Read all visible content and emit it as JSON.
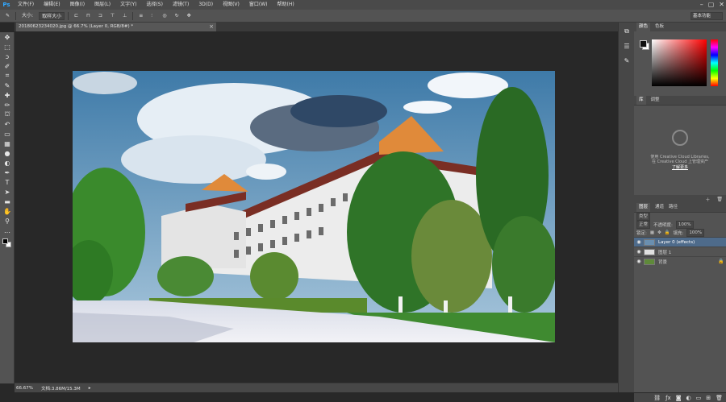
{
  "app": {
    "logo": "Ps"
  },
  "menu": [
    "文件(F)",
    "编辑(E)",
    "图像(I)",
    "图层(L)",
    "文字(Y)",
    "选择(S)",
    "滤镜(T)",
    "3D(D)",
    "视图(V)",
    "窗口(W)",
    "帮助(H)"
  ],
  "window_controls": [
    "–",
    "▢",
    "✕"
  ],
  "options": {
    "size_label": "大小:",
    "sample_label": "取样大小",
    "workspace": "基本功能"
  },
  "document": {
    "tab_title": "20180623234020.jpg @ 66.7% (Layer 0, RGB/8#) *",
    "close_glyph": "×"
  },
  "status": {
    "zoom": "66.67%",
    "doc_info": "文档:3.86M/15.3M",
    "arrow": "▸"
  },
  "panels": {
    "color_tabs": [
      "颜色",
      "色板"
    ],
    "cc_tabs": [
      "库",
      "调整"
    ],
    "cc_line1": "使用 Creative Cloud Libraries,",
    "cc_line2": "在 Creative Cloud 上管理资产",
    "cc_link": "了解更多",
    "layers_tabs": [
      "图层",
      "通道",
      "路径"
    ],
    "kind_filter": "类型",
    "blend_mode": "正常",
    "opacity_label": "不透明度:",
    "opacity_value": "100%",
    "lock_label": "锁定:",
    "fill_label": "填充:",
    "fill_value": "100%"
  },
  "layers": [
    {
      "name": "Layer 0 (effects)",
      "selected": true,
      "locked": false
    },
    {
      "name": "图层 1",
      "selected": false,
      "locked": false
    },
    {
      "name": "背景",
      "selected": false,
      "locked": true
    }
  ],
  "colors": {
    "sky": "#4f87b5",
    "building": "#e8e8e8",
    "roof": "#e08a3a",
    "tree": "#3a7a2c"
  }
}
